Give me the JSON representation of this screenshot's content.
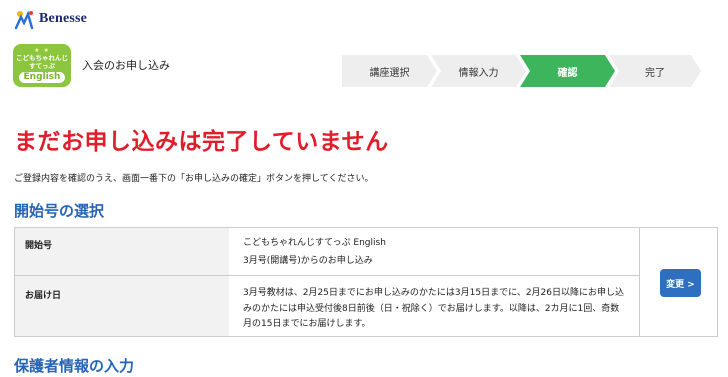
{
  "brand": {
    "logo_text": "Benesse"
  },
  "course_badge": {
    "line1": "こどもちゃれんじ",
    "line2": "すてっぷ",
    "line3": "English"
  },
  "header": {
    "title": "入会のお申し込み"
  },
  "steps": [
    {
      "label": "講座選択",
      "active": false
    },
    {
      "label": "情報入力",
      "active": false
    },
    {
      "label": "確認",
      "active": true
    },
    {
      "label": "完了",
      "active": false
    }
  ],
  "warning": "まだお申し込みは完了していません",
  "instruction": "ご登録内容を確認のうえ、画面一番下の「お申し込みの確定」ボタンを押してください。",
  "sections": {
    "start_issue": {
      "title": "開始号の選択",
      "rows": [
        {
          "label": "開始号",
          "lines": [
            "こどもちゃれんじすてっぷ English",
            "3月号(開講号)からのお申し込み"
          ]
        },
        {
          "label": "お届け日",
          "lines": [
            "3月号教材は、2月25日までにお申し込みのかたには3月15日までに、2月26日以降にお申し込",
            "みのかたには申込受付後8日前後（日・祝除く）でお届けします。以降は、2カ月に1回、奇数",
            "月の15日までにお届けします。"
          ]
        }
      ],
      "change_button": "変更 >"
    },
    "guardian": {
      "title": "保護者情報の入力"
    }
  },
  "colors": {
    "warning": "#e01e2b",
    "section_title": "#2664b5",
    "active_step": "#3db55c",
    "button": "#2f6fbf",
    "badge": "#8cc63e"
  }
}
